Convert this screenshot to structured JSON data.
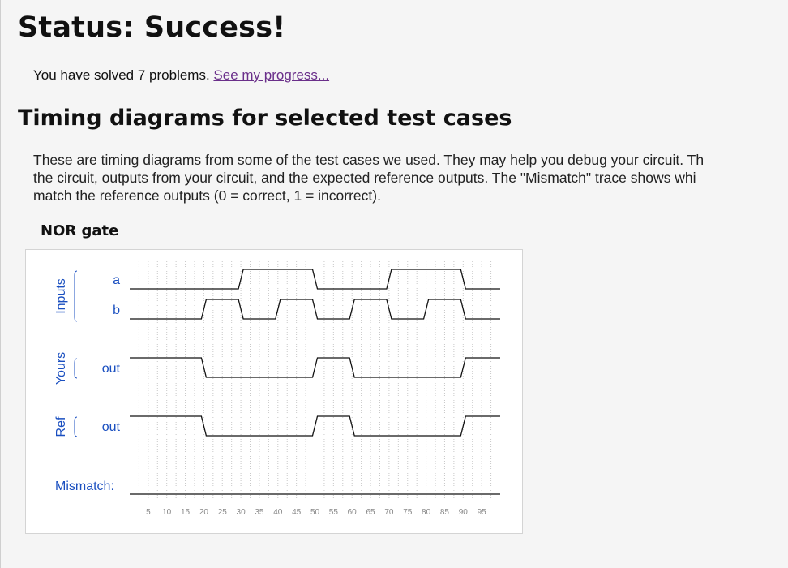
{
  "status": {
    "heading": "Status: Success!"
  },
  "progress": {
    "text": "You have solved 7 problems.",
    "link": "See my progress..."
  },
  "timing": {
    "heading": "Timing diagrams for selected test cases",
    "description_lines": [
      "These are timing diagrams from some of the test cases we used. They may help you debug your circuit. Th",
      "the circuit, outputs from your circuit, and the expected reference outputs. The \"Mismatch\" trace shows whi",
      "match the reference outputs (0 = correct, 1 = incorrect)."
    ]
  },
  "test_case": {
    "title": "NOR gate",
    "groups": {
      "inputs": "Inputs",
      "yours": "Yours",
      "ref": "Ref"
    },
    "mismatch_label": "Mismatch:",
    "signals": [
      {
        "group": "inputs",
        "name": "a",
        "changes": [
          [
            0,
            0
          ],
          [
            30,
            1
          ],
          [
            50,
            0
          ],
          [
            70,
            1
          ],
          [
            90,
            0
          ]
        ]
      },
      {
        "group": "inputs",
        "name": "b",
        "changes": [
          [
            0,
            0
          ],
          [
            20,
            1
          ],
          [
            30,
            0
          ],
          [
            40,
            1
          ],
          [
            50,
            0
          ],
          [
            60,
            1
          ],
          [
            70,
            0
          ],
          [
            80,
            1
          ],
          [
            90,
            0
          ]
        ]
      },
      {
        "group": "yours",
        "name": "out",
        "changes": [
          [
            0,
            1
          ],
          [
            20,
            0
          ],
          [
            50,
            1
          ],
          [
            60,
            0
          ],
          [
            90,
            1
          ]
        ]
      },
      {
        "group": "ref",
        "name": "out",
        "changes": [
          [
            0,
            1
          ],
          [
            20,
            0
          ],
          [
            50,
            1
          ],
          [
            60,
            0
          ],
          [
            90,
            1
          ]
        ]
      },
      {
        "group": "mismatch",
        "name": "",
        "changes": [
          [
            0,
            0
          ]
        ]
      }
    ],
    "time_start": 0,
    "time_end": 100,
    "ticks": [
      5,
      10,
      15,
      20,
      25,
      30,
      35,
      40,
      45,
      50,
      55,
      60,
      65,
      70,
      75,
      80,
      85,
      90,
      95
    ],
    "colors": {
      "label": "#1a4fc0",
      "trace": "#111111",
      "grid": "#c8c8c8",
      "tick": "#888888"
    }
  }
}
